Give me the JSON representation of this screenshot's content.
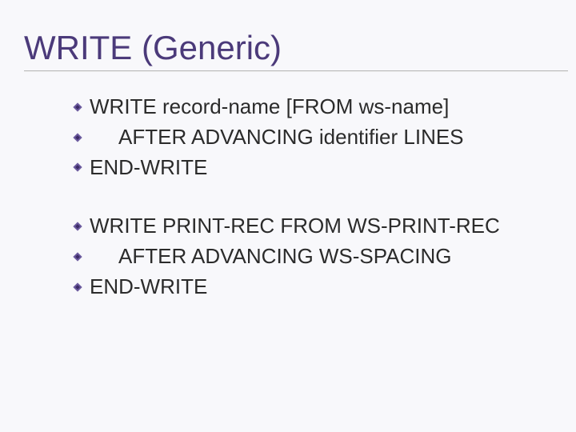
{
  "title": "WRITE (Generic)",
  "group1": {
    "line1": "WRITE record-name [FROM ws-name]",
    "line2": "AFTER ADVANCING identifier LINES",
    "line3": "END-WRITE"
  },
  "group2": {
    "line1": "WRITE PRINT-REC FROM WS-PRINT-REC",
    "line2": "AFTER ADVANCING WS-SPACING",
    "line3": "END-WRITE"
  }
}
